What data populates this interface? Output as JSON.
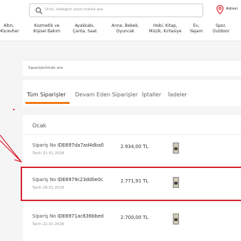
{
  "header": {
    "search_placeholder": "Ürün, kategori veya marka ara",
    "location_label": "Adresi"
  },
  "categories": [
    {
      "line1": "Altın,",
      "line2": "Mücevher"
    },
    {
      "line1": "Kozmetik ve",
      "line2": "Kişisel Bakım"
    },
    {
      "line1": "Ayakkabı,",
      "line2": "Çanta, Saat"
    },
    {
      "line1": "Anne, Bebek,",
      "line2": "Oyuncak"
    },
    {
      "line1": "Hobi, Kitap,",
      "line2": "Müzik, Kırtasiye"
    },
    {
      "line1": "Ev,",
      "line2": "Yaşam"
    },
    {
      "line1": "Spor,",
      "line2": "Outdoor"
    }
  ],
  "orders_search_placeholder": "Siparişlerimde ara",
  "tabs": [
    {
      "label": "Tüm Siparişler"
    },
    {
      "label": "Devam Eden Siparişler"
    },
    {
      "label": "İptaller"
    },
    {
      "label": "İadeler"
    }
  ],
  "month": "Ocak",
  "order_prefix": "Sipariş No",
  "date_prefix": "Tarih",
  "orders": [
    {
      "number": "IDE697da7ad4dba0",
      "date": "31.01.2026",
      "price": "2.934,00 TL"
    },
    {
      "number": "IDE6979c23dd0e0c",
      "date": "28.01.2026",
      "price": "2.771,91 TL"
    },
    {
      "number": "IDE6971ac636bbed",
      "date": "22.01.2026",
      "price": "2.700,00 TL"
    }
  ],
  "colors": {
    "accent": "#f27a1a",
    "highlight": "#d6202a"
  }
}
